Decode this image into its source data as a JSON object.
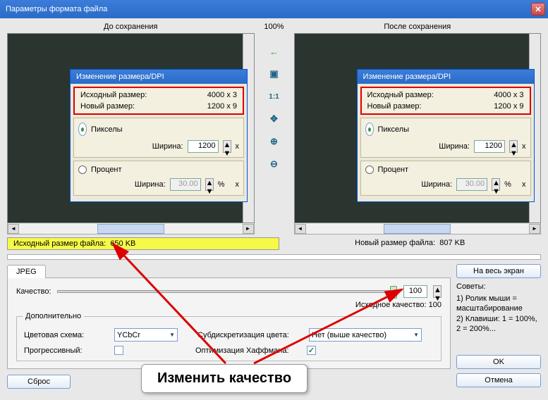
{
  "title": "Параметры формата файла",
  "preview": {
    "before": "До сохранения",
    "after": "После сохранения",
    "zoom": "100%"
  },
  "inner": {
    "title": "Изменение размера/DPI",
    "orig_label": "Исходный размер:",
    "orig_val": "4000 x 3",
    "new_label": "Новый размер:",
    "new_val": "1200 x 9",
    "pixels": "Пикселы",
    "percent": "Процент",
    "width_label": "Ширина:",
    "width_px": "1200",
    "width_pct": "30.00",
    "x": "x",
    "pct": "%"
  },
  "tools": {
    "back": "←",
    "fit": "▣",
    "one": "1:1",
    "move": "✥",
    "zin": "⊕",
    "zout": "⊖"
  },
  "filesize": {
    "orig_label": "Исходный размер файла:",
    "orig_val": "650 KB",
    "new_label": "Новый размер файла:",
    "new_val": "807 KB"
  },
  "tab": "JPEG",
  "quality": {
    "label": "Качество:",
    "value": "100",
    "orig": "Исходное качество: 100"
  },
  "extra": {
    "group": "Дополнительно",
    "colorscheme_label": "Цветовая схема:",
    "colorscheme_val": "YCbCr",
    "subsamp_label": "Субдискретизация цвета:",
    "subsamp_val": "Нет (выше качество)",
    "progressive": "Прогрессивный:",
    "huffman": "Оптимизация Хаффмана:"
  },
  "buttons": {
    "fullscreen": "На весь экран",
    "ok": "OK",
    "cancel": "Отмена",
    "reset": "Сброс"
  },
  "tips": {
    "title": "Советы:",
    "t1": "1) Ролик мыши = масштабирование",
    "t2": "2) Клавиши: 1 = 100%, 2 = 200%..."
  },
  "annotation": "Изменить качество"
}
